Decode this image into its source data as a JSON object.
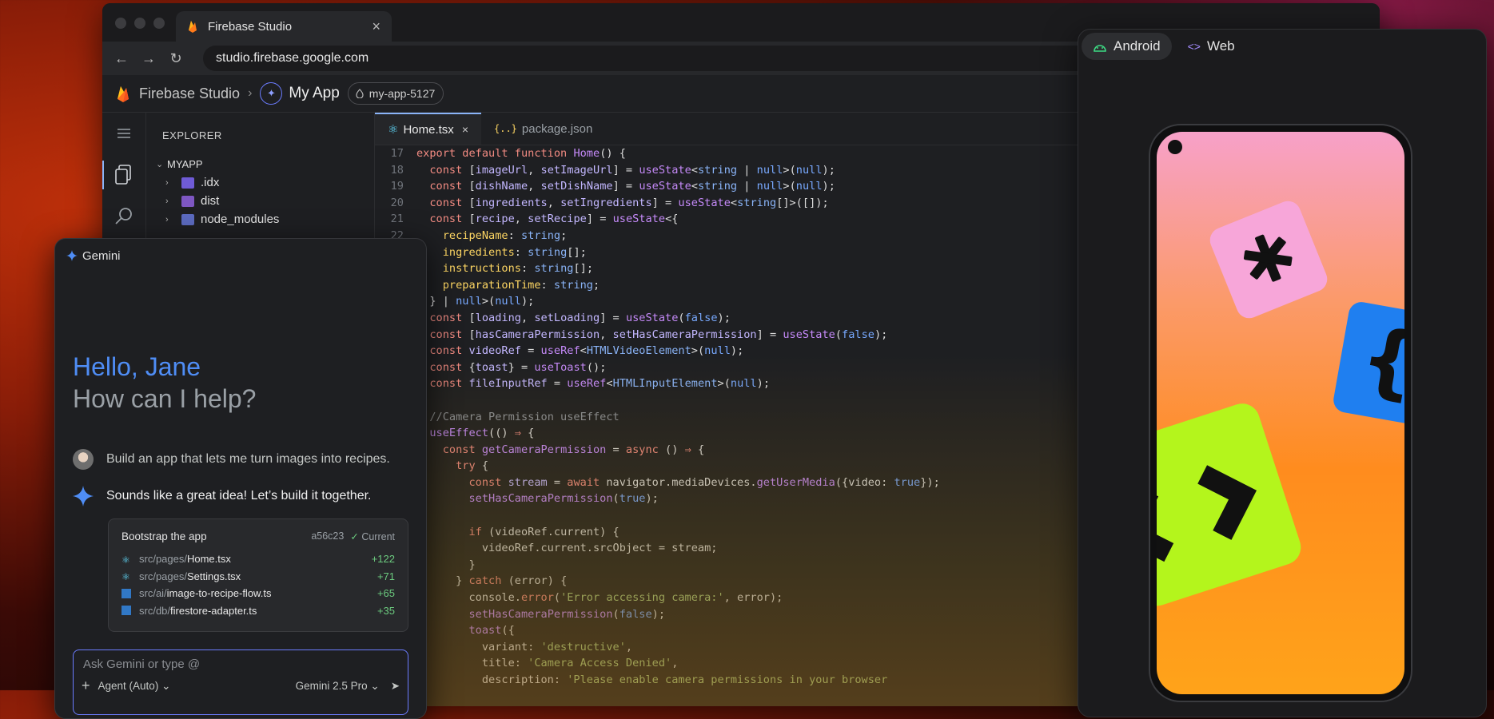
{
  "browser": {
    "tab_title": "Firebase Studio",
    "tab_close": "×",
    "url": "studio.firebase.google.com"
  },
  "studio": {
    "brand": "Firebase Studio",
    "app_name": "My App",
    "project_id": "my-app-5127"
  },
  "explorer": {
    "title": "EXPLORER",
    "root": "MYAPP",
    "items": [
      {
        "label": ".idx"
      },
      {
        "label": "dist"
      },
      {
        "label": "node_modules"
      }
    ]
  },
  "editor": {
    "tabs": [
      {
        "label": "Home.tsx",
        "close": "×"
      },
      {
        "label": "package.json"
      }
    ]
  },
  "gemini": {
    "title": "Gemini",
    "greeting": "Hello, Jane",
    "subtitle": "How can I help?",
    "user_message": "Build an app that lets me turn images into recipes.",
    "reply": "Sounds like a great idea! Let’s build it together.",
    "card": {
      "title": "Bootstrap the app",
      "commit": "a56c23",
      "status": "Current",
      "files": [
        {
          "dir": "src/pages/",
          "name": "Home.tsx",
          "added": "+122"
        },
        {
          "dir": "src/pages/",
          "name": "Settings.tsx",
          "added": "+71"
        },
        {
          "dir": "src/ai/",
          "name": "image-to-recipe-flow.ts",
          "added": "+65"
        },
        {
          "dir": "src/db/",
          "name": "firestore-adapter.ts",
          "added": "+35"
        }
      ]
    },
    "input_placeholder": "Ask Gemini or type @",
    "agent_mode": "Agent (Auto)",
    "model": "Gemini 2.5 Pro"
  },
  "preview": {
    "tabs": [
      {
        "label": "Android"
      },
      {
        "label": "Web"
      }
    ]
  }
}
